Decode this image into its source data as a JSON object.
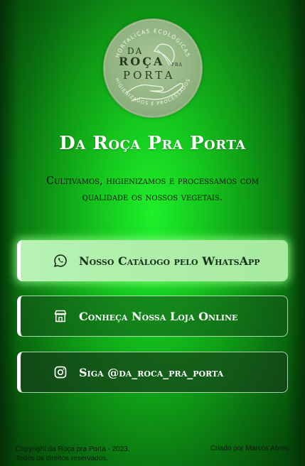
{
  "brand": {
    "logo_top_text": "HORTALIÇAS ECOLÓGICAS",
    "logo_bottom_text": "HIGIENIZADOS E PROCESSADOS",
    "logo_line1": "DA",
    "logo_line2": "ROÇA",
    "logo_line2_small": "PRA",
    "logo_line3": "PORTA"
  },
  "header": {
    "title": "Da Roça Pra Porta",
    "subtitle": "Cultivamos, higienizamos e processamos com qualidade os nossos vegetais."
  },
  "links": [
    {
      "label": "Nosso Catálogo pelo WhatsApp",
      "icon": "whatsapp-icon"
    },
    {
      "label": "Conheça Nossa Loja Online",
      "icon": "store-icon"
    },
    {
      "label": "Siga @da_roca_pra_porta",
      "icon": "instagram-icon"
    }
  ],
  "footer": {
    "copyright_line1": "Copyright da Roça pra Porta - 2023.",
    "copyright_line2": "Todos os direitos reservados.",
    "credit": "Criado por Marcos Abreu"
  },
  "colors": {
    "background_center": "#1ef02a",
    "background_edge": "#064a0a",
    "primary_button": "#b7f2b4",
    "logo_bg": "#8fb27f"
  }
}
